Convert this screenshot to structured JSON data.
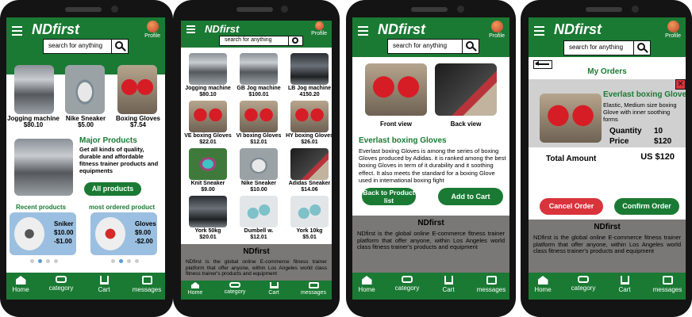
{
  "app": {
    "brand": "NDfirst",
    "profile": "Profile",
    "search_placeholder": "search for anything"
  },
  "nav": [
    "Home",
    "category",
    "Cart",
    "messages"
  ],
  "home": {
    "products": [
      {
        "name": "Jogging machine",
        "price": "$80.10"
      },
      {
        "name": "Nike Sneaker",
        "price": "$5.00"
      },
      {
        "name": "Boxing Gloves",
        "price": "$7.54"
      }
    ],
    "promo_title": "Major Products",
    "promo_text": "Get all kinds of quality, durable and affordable fitness trainer products and equipments",
    "all_button": "All products",
    "recent_label": "Recent products",
    "most_label": "most ordered product",
    "recent": {
      "name": "Sniker",
      "price": "$10.00",
      "discount": "-$1.00"
    },
    "most": {
      "name": "Gloves",
      "price": "$9.00",
      "discount": "-$2.00"
    }
  },
  "category": {
    "items": [
      {
        "name": "Jogging machine",
        "price": "$80.10"
      },
      {
        "name": "GB Jog machine",
        "price": "$100.01"
      },
      {
        "name": "LB Jog machine",
        "price": "4150.20"
      },
      {
        "name": "VE boxing Gloves",
        "price": "$22.01"
      },
      {
        "name": "VI boxing Gloves",
        "price": "$12.01"
      },
      {
        "name": "HY boxing Gloves",
        "price": "$26.01"
      },
      {
        "name": "Knit Sneaker",
        "price": "$9.00"
      },
      {
        "name": "Nike Sneaker",
        "price": "$10.00"
      },
      {
        "name": "Adidas Sneaker",
        "price": "$14.06"
      },
      {
        "name": "York 50kg",
        "price": "$20.01"
      },
      {
        "name": "Dumbell w.",
        "price": "$12.01"
      },
      {
        "name": "York 10kg",
        "price": "$5.01"
      }
    ]
  },
  "footer": {
    "title": "NDfirst",
    "text": "NDfirst is the global online E-commerce fitness trainer platform that offer anyone, within Los Angeles world class fitness trainer's products and equipment"
  },
  "product": {
    "front": "Front view",
    "back": "Back view",
    "title": "Everlast boxing Gloves",
    "desc": "Everlast boxing Gloves is among the series of boxing Gloves produced by Adidas. it is ranked among the best boxing Gloves in term of it durability and it soothing effect. It also meets the standard for a boxing Glove used in international boxing fight",
    "back_button": "Back to Product list",
    "cart_button": "Add to Cart"
  },
  "orders": {
    "title": "My Orders",
    "item_title": "Everlast boxing Gloves",
    "item_desc": "Elastic, Medium size boxing Glove with inner soothing forms",
    "qty_label": "Quantity",
    "qty": "10",
    "price_label": "Price",
    "price": "$120",
    "total_label": "Total Amount",
    "total": "US $120",
    "cancel": "Cancel Order",
    "confirm": "Confirm Order"
  },
  "colors": {
    "green": "#1a7a33",
    "red": "#d9333b",
    "footer": "#7a7777"
  }
}
